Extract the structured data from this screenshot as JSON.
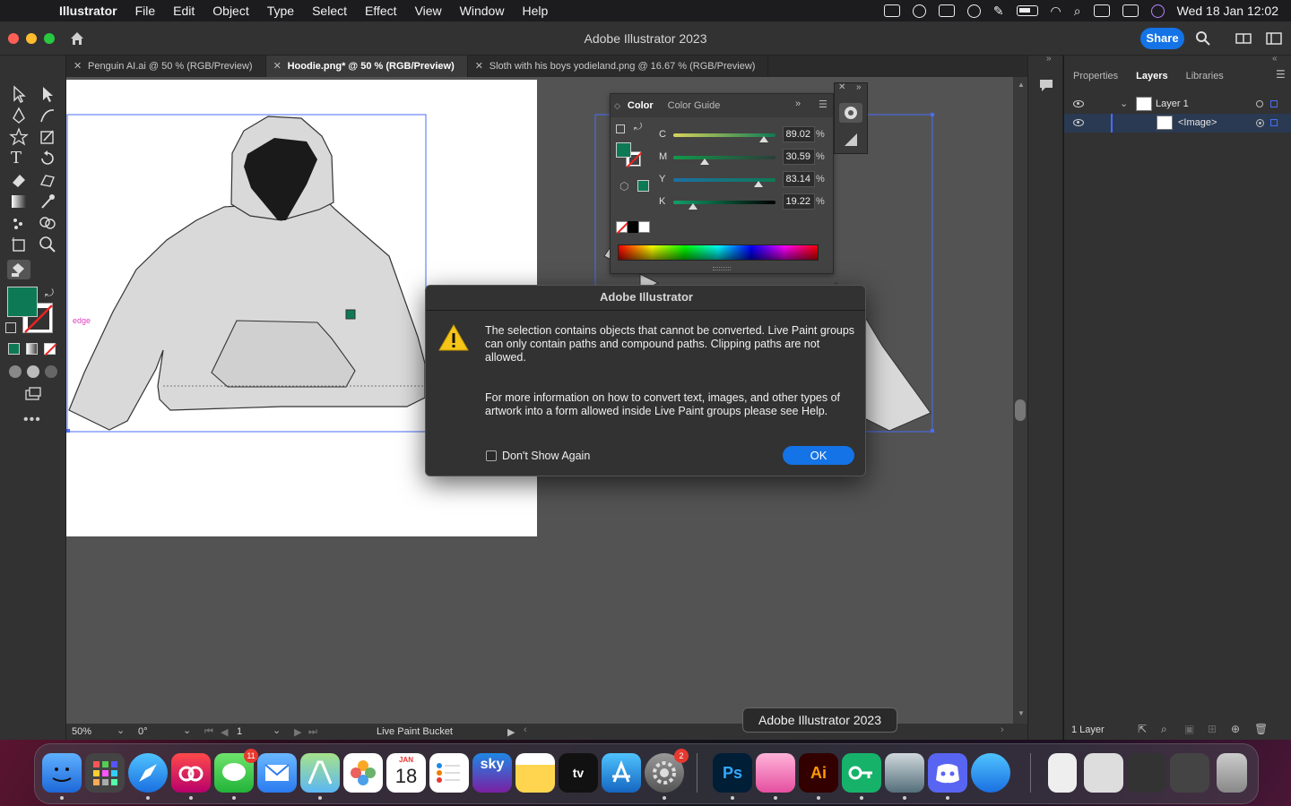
{
  "menubar": {
    "app_name": "Illustrator",
    "items": [
      "File",
      "Edit",
      "Object",
      "Type",
      "Select",
      "Effect",
      "View",
      "Window",
      "Help"
    ],
    "clock": "Wed 18 Jan 12:02"
  },
  "titlebar": {
    "title": "Adobe Illustrator 2023",
    "share_label": "Share"
  },
  "tabs": [
    {
      "label": "Penguin AI.ai @ 50 % (RGB/Preview)"
    },
    {
      "label": "Hoodie.png* @ 50 % (RGB/Preview)"
    },
    {
      "label": "Sloth with his boys yodieland.png @ 16.67 % (RGB/Preview)"
    }
  ],
  "canvas": {
    "edge_label": "edge"
  },
  "color_panel": {
    "tab_color": "Color",
    "tab_guide": "Color Guide",
    "sliders": [
      {
        "label": "C",
        "value": "89.02",
        "unit": "%",
        "level": 0.8902
      },
      {
        "label": "M",
        "value": "30.59",
        "unit": "%",
        "level": 0.3059
      },
      {
        "label": "Y",
        "value": "83.14",
        "unit": "%",
        "level": 0.8314
      },
      {
        "label": "K",
        "value": "19.22",
        "unit": "%",
        "level": 0.1922
      }
    ],
    "fill_color": "#0e7a55"
  },
  "dialog": {
    "title": "Adobe Illustrator",
    "message1": "The selection contains objects that cannot be converted. Live Paint groups can only contain paths and compound paths. Clipping paths are not allowed.",
    "message2": "For more information on how to convert text, images, and other types of artwork into a form allowed inside Live Paint groups please see Help.",
    "checkbox_label": "Don't Show Again",
    "ok_label": "OK"
  },
  "layers_panel": {
    "tabs": [
      "Properties",
      "Layers",
      "Libraries"
    ],
    "rows": [
      {
        "name": "Layer 1"
      },
      {
        "name": "<Image>"
      }
    ],
    "footer": "1 Layer"
  },
  "statusbar": {
    "zoom": "50%",
    "rotation": "0°",
    "artboard": "1",
    "tool": "Live Paint Bucket"
  },
  "tooltip": "Adobe Illustrator 2023",
  "dock": {
    "calendar_month": "JAN",
    "calendar_day": "18",
    "messages_badge": "11",
    "settings_badge": "2",
    "ps_label": "Ps",
    "ai_label": "Ai",
    "sky_label": "sky",
    "tv_label": "tv"
  },
  "colors": {
    "accent": "#1473e6",
    "selection": "#4a6cf7"
  }
}
